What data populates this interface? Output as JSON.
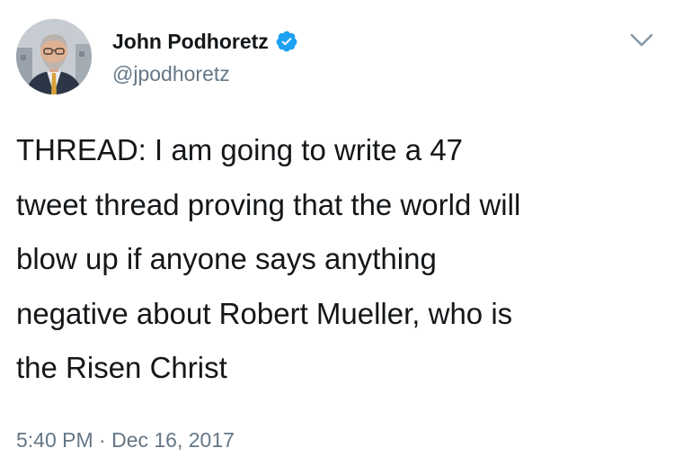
{
  "tweet": {
    "author": {
      "name": "John Podhoretz",
      "handle": "@jpodhoretz",
      "verified": true
    },
    "text": "THREAD: I am going to write a 47\ntweet thread proving that the world will\nblow up if anyone says anything\nnegative about Robert Mueller, who is\nthe Risen Christ",
    "timestamp": "5:40 PM · Dec 16, 2017",
    "icons": {
      "verified": "verified-badge-icon",
      "menu": "chevron-down-icon"
    }
  },
  "colors": {
    "text": "#14171a",
    "secondary": "#657786",
    "verified": "#1da1f2",
    "background": "#ffffff"
  }
}
